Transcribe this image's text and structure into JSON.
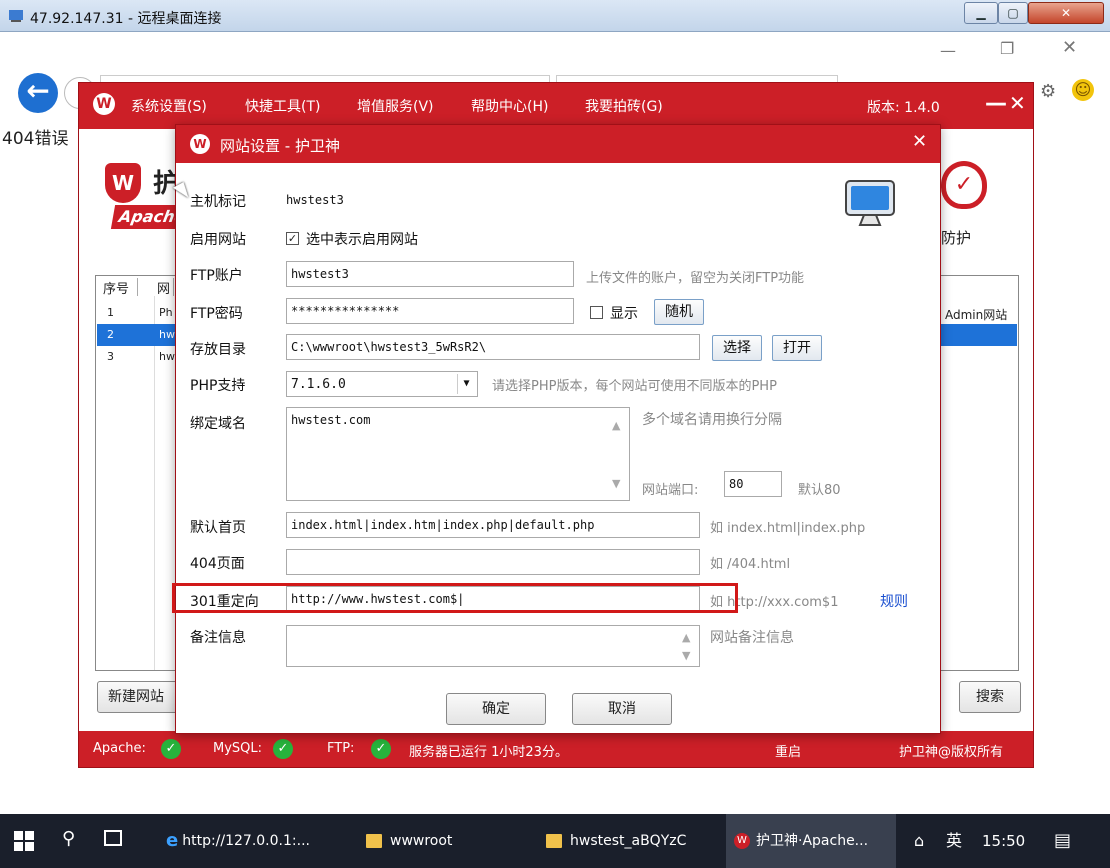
{
  "rdp": {
    "title": "47.92.147.31 - 远程桌面连接"
  },
  "browser": {
    "page_text": "404错误"
  },
  "app": {
    "menu": [
      "系统设置(S)",
      "快捷工具(T)",
      "增值服务(V)",
      "帮助中心(H)",
      "我要拍砖(G)"
    ],
    "version": "版本: 1.4.0",
    "logo_text": "护",
    "apache_tag": "Apache",
    "right_label": "防护",
    "table": {
      "headers": [
        "序号",
        "网"
      ],
      "rows": [
        {
          "num": "1",
          "name": "Ph",
          "right": "Admin网站"
        },
        {
          "num": "2",
          "name": "hw",
          "right": ""
        },
        {
          "num": "3",
          "name": "hw",
          "right": ""
        }
      ]
    },
    "new_site": "新建网站",
    "search": "搜索",
    "status": {
      "apache": "Apache:",
      "mysql": "MySQL:",
      "ftp": "FTP:",
      "running": "服务器已运行 1小时23分。",
      "restart": "重启",
      "copyright": "护卫神@版权所有"
    }
  },
  "modal": {
    "title": "网站设置 - 护卫神",
    "host_label": "主机标记",
    "host_value": "hwstest3",
    "enable_label": "启用网站",
    "enable_text": "选中表示启用网站",
    "ftp_user_label": "FTP账户",
    "ftp_user_value": "hwstest3",
    "ftp_user_hint": "上传文件的账户，留空为关闭FTP功能",
    "ftp_pass_label": "FTP密码",
    "ftp_pass_value": "***************",
    "show_label": "显示",
    "random_btn": "随机",
    "dir_label": "存放目录",
    "dir_value": "C:\\wwwroot\\hwstest3_5wRsR2\\",
    "choose_btn": "选择",
    "open_btn": "打开",
    "php_label": "PHP支持",
    "php_value": "7.1.6.0",
    "php_hint": "请选择PHP版本，每个网站可使用不同版本的PHP",
    "domain_label": "绑定域名",
    "domain_value": "hwstest.com",
    "domain_hint": "多个域名请用换行分隔",
    "port_label": "网站端口:",
    "port_value": "80",
    "port_hint": "默认80",
    "index_label": "默认首页",
    "index_value": "index.html|index.htm|index.php|default.php",
    "index_hint": "如 index.html|index.php",
    "p404_label": "404页面",
    "p404_value": "",
    "p404_hint": "如 /404.html",
    "redirect_label": "301重定向",
    "redirect_value": "http://www.hwstest.com$|",
    "redirect_hint": "如 http://xxx.com$1",
    "rules_link": "规则",
    "note_label": "备注信息",
    "note_value": "",
    "note_hint": "网站备注信息",
    "ok_btn": "确定",
    "cancel_btn": "取消"
  },
  "taskbar": {
    "ie": "http://127.0.0.1:...",
    "folder1": "wwwroot",
    "folder2": "hwstest_aBQYzC",
    "app": "护卫神·Apache...",
    "lang": "英",
    "time": "15:50"
  }
}
